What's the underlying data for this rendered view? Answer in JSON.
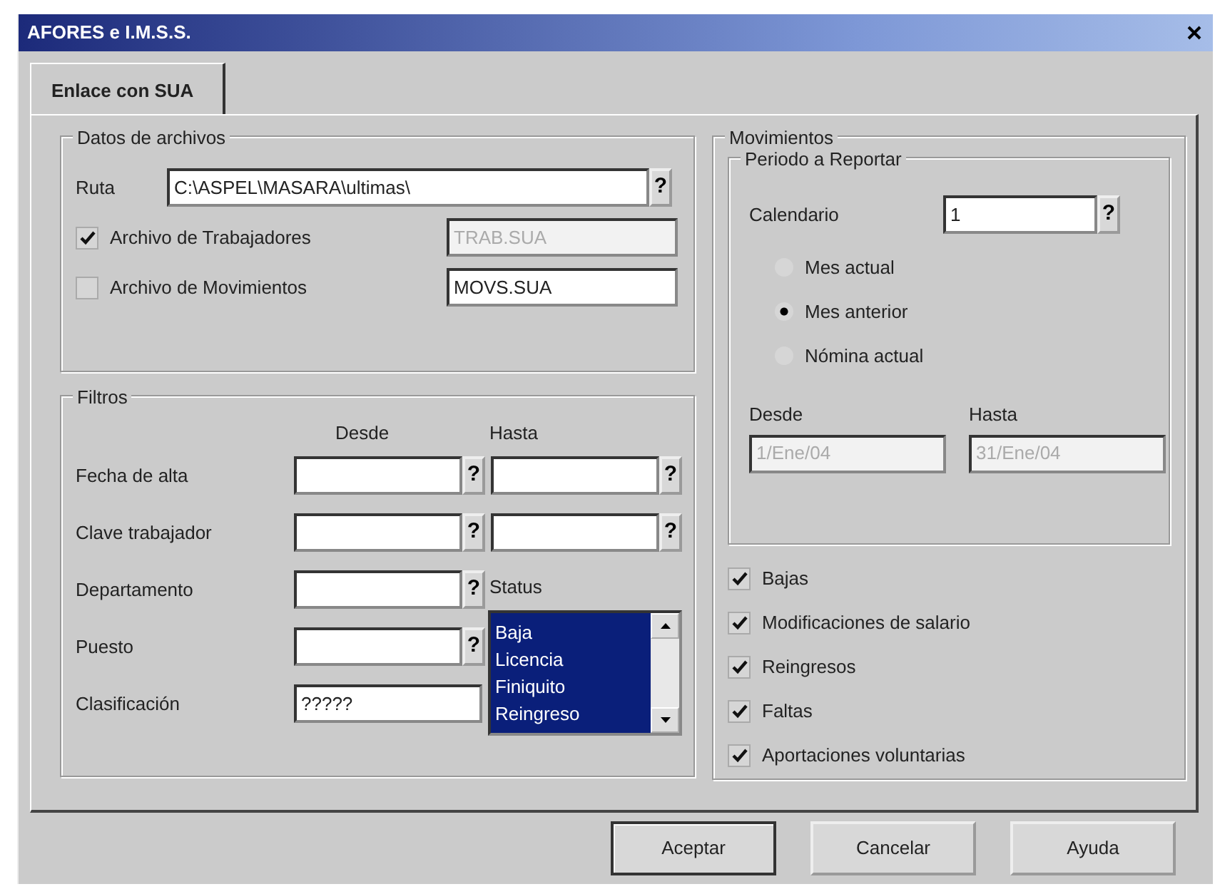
{
  "window": {
    "title": "AFORES e I.M.S.S."
  },
  "tabs": [
    {
      "label": "Enlace con SUA",
      "selected": true
    }
  ],
  "datos_de_archivos": {
    "title": "Datos de archivos",
    "ruta": {
      "label": "Ruta",
      "value": "C:\\ASPEL\\MASARA\\ultimas\\",
      "help": "?"
    },
    "archivos": [
      {
        "label": "Archivo de Trabajadores",
        "checked": true,
        "value": "TRAB.SUA",
        "disabled": true
      },
      {
        "label": "Archivo de Movimientos",
        "checked": false,
        "value": "MOVS.SUA",
        "disabled": false
      }
    ]
  },
  "filtros": {
    "title": "Filtros",
    "desde": "Desde",
    "hasta": "Hasta",
    "rows": [
      {
        "label": "Fecha de alta",
        "kind": "range",
        "help": "?"
      },
      {
        "label": "Clave trabajador",
        "kind": "range",
        "help": "?"
      },
      {
        "label": "Departamento",
        "kind": "single",
        "help": "?"
      },
      {
        "label": "Puesto",
        "kind": "single",
        "help": "?"
      },
      {
        "label": "Clasificación",
        "kind": "text",
        "value": "?????"
      }
    ],
    "status": {
      "label": "Status",
      "items": [
        {
          "label": "Baja",
          "selected": true
        },
        {
          "label": "Licencia",
          "selected": true
        },
        {
          "label": "Finiquito",
          "selected": true
        },
        {
          "label": "Reingreso",
          "selected": true
        }
      ]
    }
  },
  "movimientos": {
    "title": "Movimientos",
    "periodo": {
      "title": "Periodo a Reportar",
      "calendario": {
        "label": "Calendario",
        "value": "1",
        "help": "?"
      },
      "opciones": [
        {
          "label": "Mes actual",
          "selected": false
        },
        {
          "label": "Mes anterior",
          "selected": true
        },
        {
          "label": "Nómina actual",
          "selected": false
        }
      ],
      "desde": {
        "label": "Desde",
        "value": "1/Ene/04"
      },
      "hasta": {
        "label": "Hasta",
        "value": "31/Ene/04"
      }
    },
    "incluir": [
      {
        "label": "Bajas",
        "checked": true
      },
      {
        "label": "Modificaciones de salario",
        "checked": true
      },
      {
        "label": "Reingresos",
        "checked": true
      },
      {
        "label": "Faltas",
        "checked": true
      },
      {
        "label": "Aportaciones voluntarias",
        "checked": true
      }
    ]
  },
  "buttons": [
    {
      "label": "Aceptar",
      "default": true
    },
    {
      "label": "Cancelar",
      "default": false
    },
    {
      "label": "Ayuda",
      "default": false
    }
  ]
}
